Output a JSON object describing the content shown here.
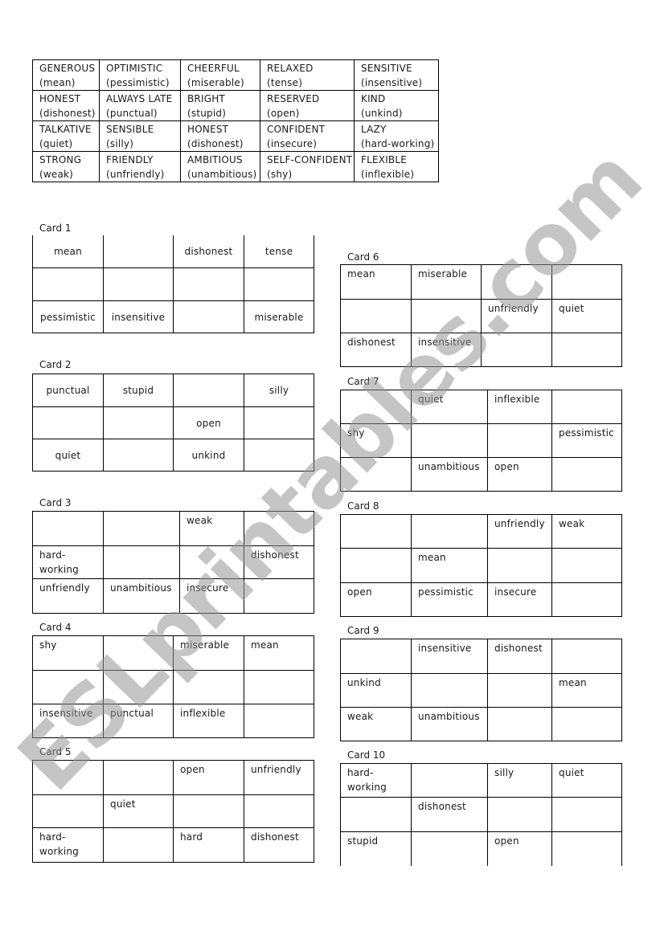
{
  "key_table": [
    [
      {
        "word": "GENEROUS",
        "opposite": "(mean)"
      },
      {
        "word": "OPTIMISTIC",
        "opposite": "(pessimistic)"
      },
      {
        "word": "CHEERFUL",
        "opposite": "(miserable)"
      },
      {
        "word": "RELAXED",
        "opposite": "(tense)"
      },
      {
        "word": "SENSITIVE",
        "opposite": "(insensitive)"
      }
    ],
    [
      {
        "word": "HONEST",
        "opposite": "(dishonest)"
      },
      {
        "word": "ALWAYS LATE",
        "opposite": "(punctual)"
      },
      {
        "word": "BRIGHT",
        "opposite": "(stupid)"
      },
      {
        "word": "RESERVED",
        "opposite": "(open)"
      },
      {
        "word": "KIND",
        "opposite": "(unkind)"
      }
    ],
    [
      {
        "word": "TALKATIVE",
        "opposite": "(quiet)"
      },
      {
        "word": "SENSIBLE",
        "opposite": "(silly)"
      },
      {
        "word": "HONEST",
        "opposite": "(dishonest)"
      },
      {
        "word": "CONFIDENT",
        "opposite": "(insecure)"
      },
      {
        "word": "LAZY",
        "opposite": "(hard-working)"
      }
    ],
    [
      {
        "word": "STRONG",
        "opposite": "(weak)"
      },
      {
        "word": "FRIENDLY",
        "opposite": "(unfriendly)"
      },
      {
        "word": "AMBITIOUS",
        "opposite": "(unambitious)"
      },
      {
        "word": "SELF-CONFIDENT",
        "opposite": "(shy)"
      },
      {
        "word": "FLEXIBLE",
        "opposite": "(inflexible)"
      }
    ]
  ],
  "cards": [
    {
      "label": "Card 1",
      "rows": [
        [
          "mean",
          "",
          "dishonest",
          "tense"
        ],
        [
          "",
          "",
          "",
          ""
        ],
        [
          "pessimistic",
          "insensitive",
          "",
          "miserable"
        ]
      ]
    },
    {
      "label": "Card 2",
      "rows": [
        [
          "punctual",
          "stupid",
          "",
          "silly"
        ],
        [
          "",
          "",
          "open",
          ""
        ],
        [
          "quiet",
          "",
          "unkind",
          ""
        ]
      ]
    },
    {
      "label": "Card 3",
      "rows": [
        [
          "",
          "",
          "weak",
          ""
        ],
        [
          "hard-working",
          "",
          "",
          "dishonest"
        ],
        [
          "unfriendly",
          "unambitious",
          "insecure",
          ""
        ]
      ]
    },
    {
      "label": "Card 4",
      "rows": [
        [
          "shy",
          "",
          "miserable",
          "mean"
        ],
        [
          "",
          "",
          "",
          ""
        ],
        [
          "insensitive",
          "punctual",
          "inflexible",
          ""
        ]
      ]
    },
    {
      "label": "Card 5",
      "rows": [
        [
          "",
          "",
          "open",
          "unfriendly"
        ],
        [
          "",
          "quiet",
          "",
          ""
        ],
        [
          "hard-working",
          "",
          "hard",
          "dishonest"
        ]
      ]
    },
    {
      "label": "Card 6",
      "rows": [
        [
          "mean",
          "miserable",
          "",
          ""
        ],
        [
          "",
          "",
          "unfriendly",
          "quiet"
        ],
        [
          "dishonest",
          "insensitive",
          "",
          ""
        ]
      ]
    },
    {
      "label": "Card 7",
      "rows": [
        [
          "",
          "quiet",
          "inflexible",
          ""
        ],
        [
          "shy",
          "",
          "",
          "pessimistic"
        ],
        [
          "",
          "unambitious",
          "open",
          ""
        ]
      ]
    },
    {
      "label": "Card 8",
      "rows": [
        [
          "",
          "",
          "unfriendly",
          "weak"
        ],
        [
          "",
          "mean",
          "",
          ""
        ],
        [
          "open",
          "pessimistic",
          "insecure",
          ""
        ]
      ]
    },
    {
      "label": "Card 9",
      "rows": [
        [
          "",
          "insensitive",
          "dishonest",
          ""
        ],
        [
          "unkind",
          "",
          "",
          "mean"
        ],
        [
          "weak",
          "unambitious",
          "",
          ""
        ]
      ]
    },
    {
      "label": "Card 10",
      "rows": [
        [
          "hard-working",
          "",
          "silly",
          "quiet"
        ],
        [
          "",
          "dishonest",
          "",
          ""
        ],
        [
          "stupid",
          "",
          "open",
          ""
        ]
      ]
    }
  ],
  "watermark": {
    "text": "ESLprintables.com",
    "color": "#969696"
  }
}
